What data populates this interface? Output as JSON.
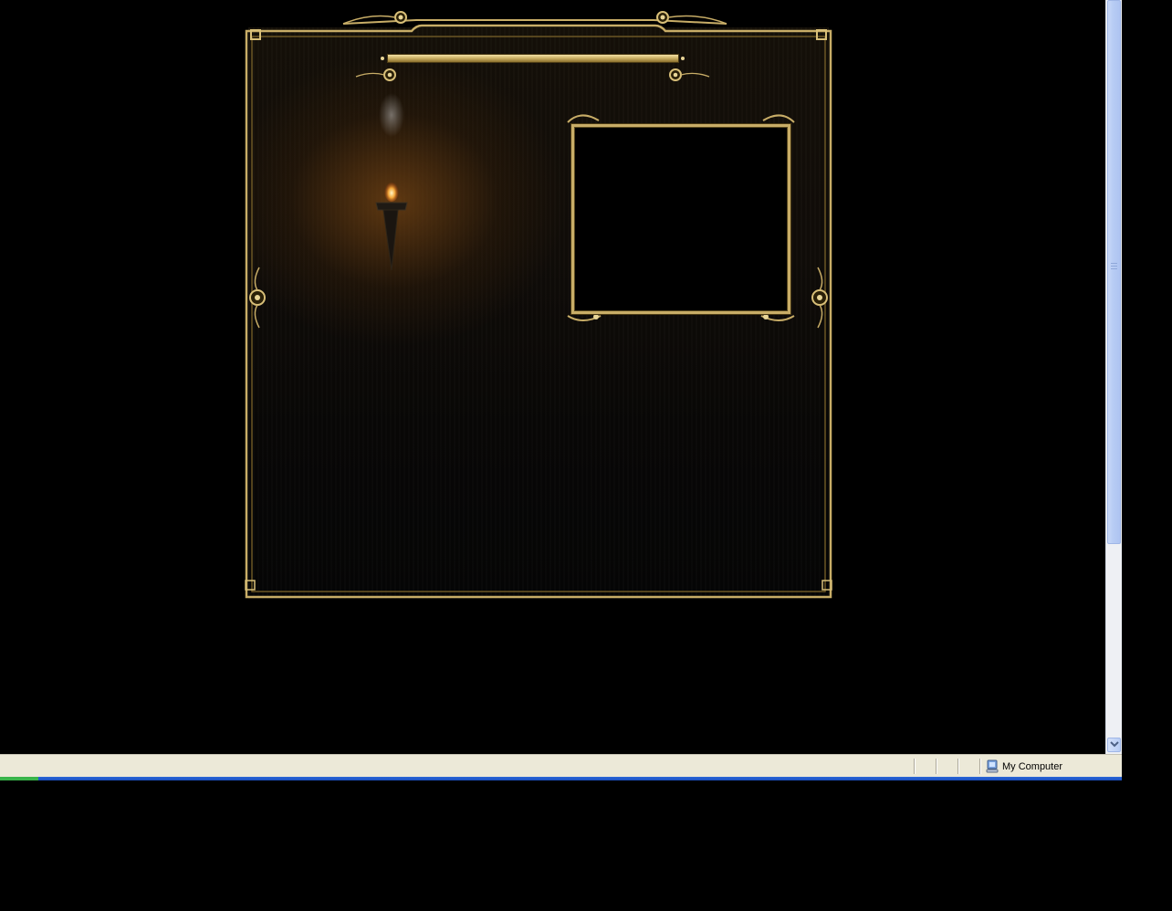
{
  "statusbar": {
    "zone_label": "My Computer",
    "zone_icon": "computer-icon",
    "progress_fraction": 0.034
  },
  "scrollbar": {
    "thumb_icon": "scroll-thumb",
    "down_icon": "chevron-down-icon"
  },
  "game": {
    "frame_color": "#c8ad67",
    "background_color": "#0b0906",
    "light_color": "#7a4a16"
  }
}
